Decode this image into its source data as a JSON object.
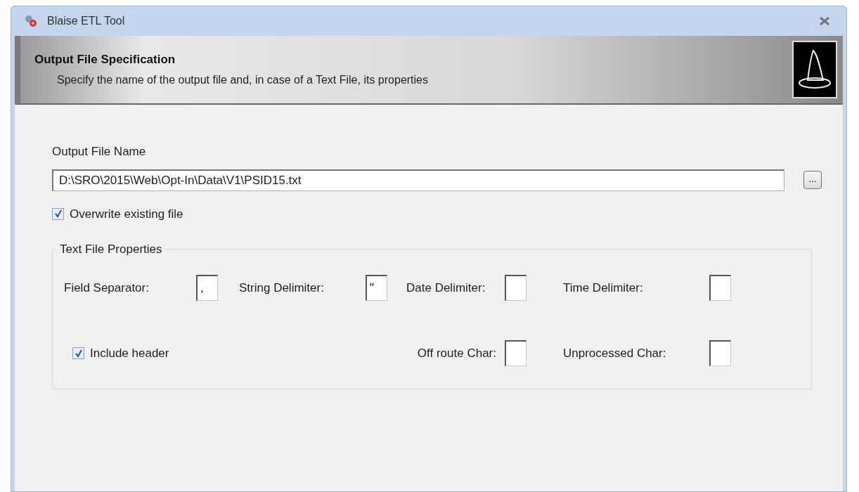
{
  "window": {
    "title": "Blaise ETL Tool"
  },
  "header": {
    "title": "Output File Specification",
    "subtitle": "Specify the name of the output file and, in case of a Text File, its properties"
  },
  "output_file": {
    "label": "Output File Name",
    "value": "D:\\SRO\\2015\\Web\\Opt-In\\Data\\V1\\PSID15.txt",
    "browse": "..."
  },
  "overwrite": {
    "label": "Overwrite existing file",
    "checked": true
  },
  "text_file_properties": {
    "title": "Text File Properties",
    "row_1": [
      {
        "label": "Field Separator:",
        "value": ","
      },
      {
        "label": "String Delimiter:",
        "value": "\""
      },
      {
        "label": "Date Delimiter:"
      },
      {
        "label": "Time Delimiter:"
      }
    ],
    "include_header": {
      "label": "Include header",
      "checked": true
    },
    "row_2": [
      {
        "label": "Off route Char:"
      },
      {
        "label": "Unprocessed Char:"
      }
    ]
  }
}
